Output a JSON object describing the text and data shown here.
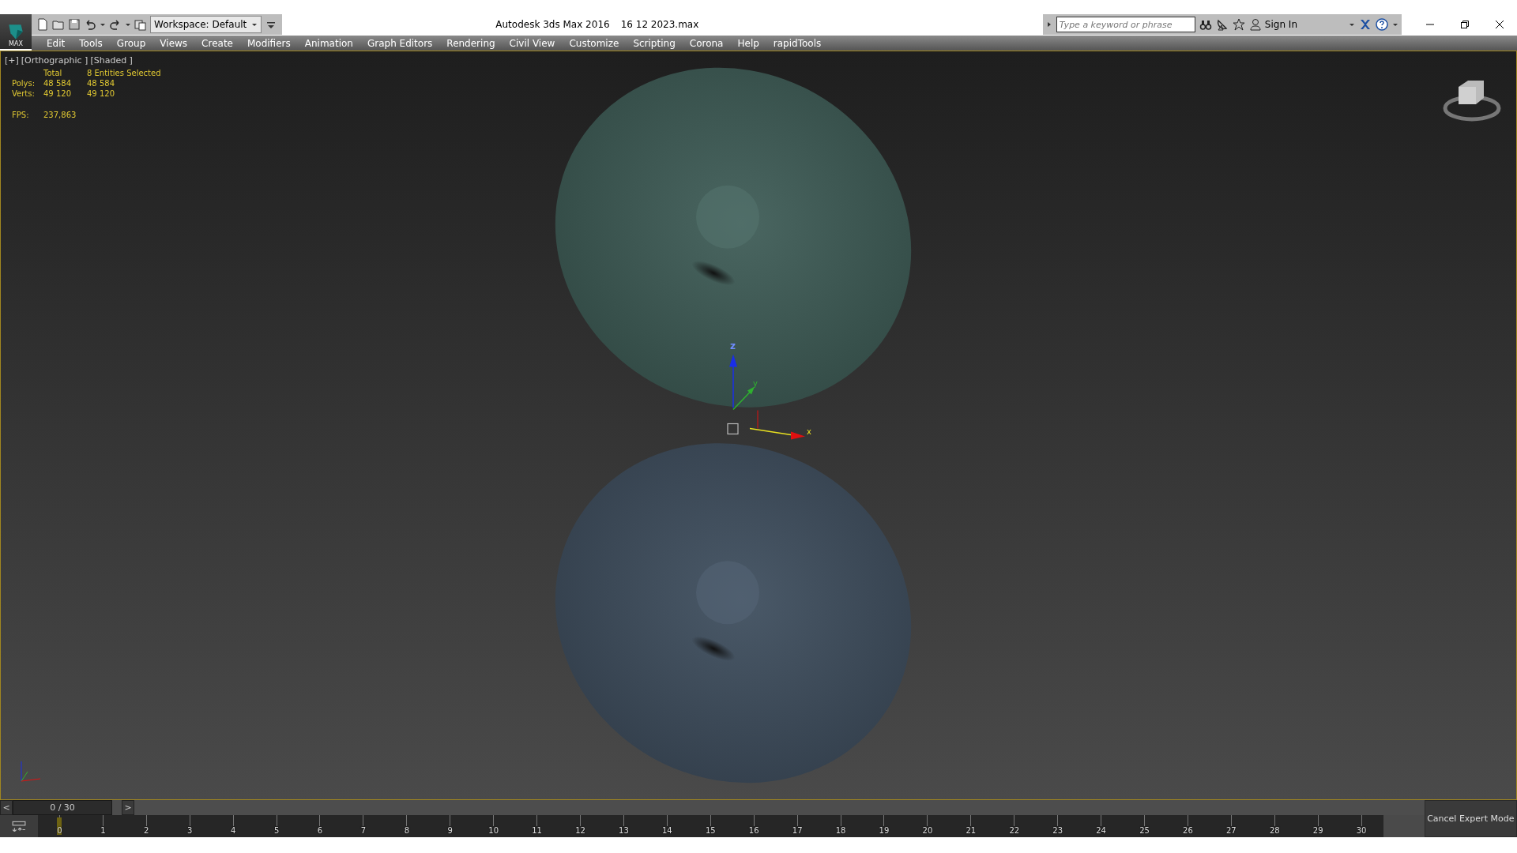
{
  "app": {
    "logo_label": "MAX"
  },
  "toolbar": {
    "workspace": "Workspace: Default"
  },
  "title": {
    "app": "Autodesk 3ds Max 2016",
    "file": "16 12 2023.max"
  },
  "search": {
    "placeholder": "Type a keyword or phrase"
  },
  "sign_in": "Sign In",
  "menu": [
    "Edit",
    "Tools",
    "Group",
    "Views",
    "Create",
    "Modifiers",
    "Animation",
    "Graph Editors",
    "Rendering",
    "Civil View",
    "Customize",
    "Scripting",
    "Corona",
    "Help",
    "rapidTools"
  ],
  "viewport": {
    "labels": [
      "[+]",
      "[Orthographic ]",
      "[Shaded ]"
    ],
    "stats": {
      "header": [
        "Total",
        "8 Entities Selected"
      ],
      "rows": [
        {
          "label": "Polys:",
          "total": "48 584",
          "selected": "48 584"
        },
        {
          "label": "Verts:",
          "total": "49 120",
          "selected": "49 120"
        }
      ],
      "fps_label": "FPS:",
      "fps": "237,863"
    },
    "gizmo_axes": [
      "x",
      "y",
      "z"
    ]
  },
  "time_slider": {
    "prev": "<",
    "label": "0 / 30",
    "next": ">",
    "level": 0
  },
  "frames": [
    "0",
    "1",
    "2",
    "3",
    "4",
    "5",
    "6",
    "7",
    "8",
    "9",
    "10",
    "11",
    "12",
    "13",
    "14",
    "15",
    "16",
    "17",
    "18",
    "19",
    "20",
    "21",
    "22",
    "23",
    "24",
    "25",
    "26",
    "27",
    "28",
    "29",
    "30"
  ],
  "expert_button": "Cancel Expert Mode"
}
